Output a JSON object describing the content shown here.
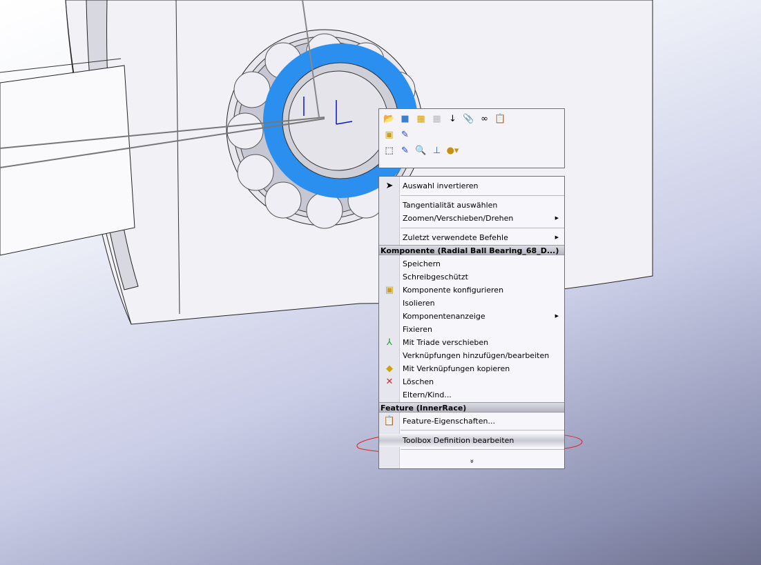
{
  "toolbar": {
    "icons": [
      [
        "open-part-icon",
        "edit-component-icon",
        "hide-components-icon",
        "show-components-icon",
        "reorder-icon",
        "clip-icon",
        "smart-mates-icon",
        "properties-icon"
      ],
      [
        "configure-component-icon",
        "edit-sketch-icon"
      ],
      [
        "select-icon",
        "sketch-icon",
        "zoom-to-selection-icon",
        "normal-to-icon",
        "appearance-icon"
      ]
    ]
  },
  "menu": {
    "general": [
      {
        "label": "Auswahl invertieren",
        "icon": "select-arrow-icon"
      },
      {
        "label": "Tangentialität auswählen"
      },
      {
        "label": "Zoomen/Verschieben/Drehen",
        "submenu": true
      },
      {
        "label": "Zuletzt verwendete Befehle",
        "submenu": true
      }
    ],
    "component_header": "Komponente (Radial Ball Bearing_68_D...)",
    "component": [
      {
        "label": "Speichern"
      },
      {
        "label": "Schreibgeschützt"
      },
      {
        "label": "Komponente konfigurieren",
        "icon": "configure-component-icon"
      },
      {
        "label": "Isolieren"
      },
      {
        "label": "Komponentenanzeige",
        "submenu": true
      },
      {
        "label": "Fixieren"
      },
      {
        "label": "Mit Triade verschieben",
        "icon": "triad-icon"
      },
      {
        "label": "Verknüpfungen hinzufügen/bearbeiten"
      },
      {
        "label": "Mit Verknüpfungen kopieren",
        "icon": "copy-with-mates-icon"
      },
      {
        "label": "Löschen",
        "icon": "delete-icon"
      },
      {
        "label": "Eltern/Kind..."
      }
    ],
    "feature_header": "Feature (InnerRace)",
    "feature": [
      {
        "label": "Feature-Eigenschaften...",
        "icon": "feature-properties-icon"
      },
      {
        "label": "Toolbox Definition bearbeiten"
      }
    ],
    "expand": "»"
  },
  "colors": {
    "selection": "#2b8ff0",
    "annotation": "#e02020"
  }
}
